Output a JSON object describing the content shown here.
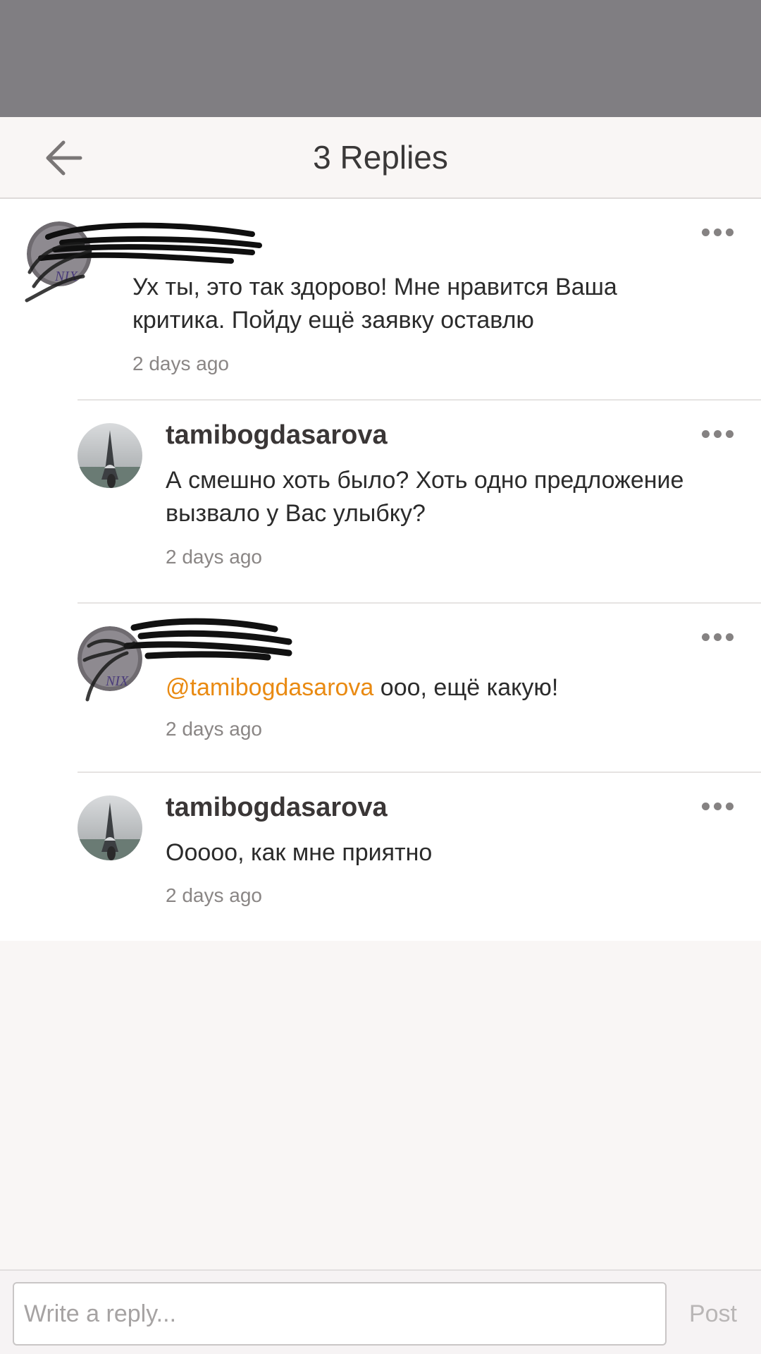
{
  "header": {
    "title": "3 Replies"
  },
  "parent_comment": {
    "username": "",
    "text": "Ух ты, это так здорово! Мне нравится Ваша критика. Пойду ещё заявку оставлю",
    "time": "2 days ago"
  },
  "replies": [
    {
      "username": "tamibogdasarova",
      "text": "А смешно хоть было? Хоть одно предложение вызвало у Вас улыбку?",
      "time": "2 days ago"
    },
    {
      "username": "",
      "mention": "@tamibogdasarova",
      "text": " ооо, ещё какую!",
      "time": "2 days ago"
    },
    {
      "username": "tamibogdasarova",
      "text": "Ооооо, как мне приятно",
      "time": "2 days ago"
    }
  ],
  "footer": {
    "input_placeholder": "Write a reply...",
    "input_value": "",
    "post_label": "Post"
  },
  "colors": {
    "accent_mention": "#e98a12",
    "overlay": "#807e82",
    "background": "#f9f6f5"
  },
  "icons": {
    "back": "arrow-left-icon",
    "more": "more-horizontal-icon"
  }
}
